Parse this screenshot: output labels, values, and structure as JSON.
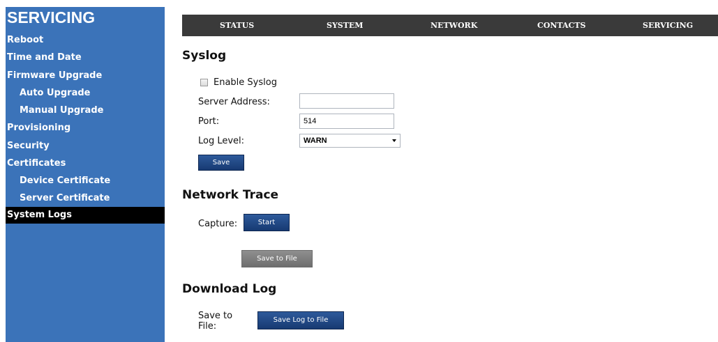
{
  "sidebar": {
    "title": "SERVICING",
    "items": [
      {
        "label": "Reboot"
      },
      {
        "label": "Time and Date"
      },
      {
        "label": "Firmware Upgrade"
      },
      {
        "label": "Auto Upgrade"
      },
      {
        "label": "Manual Upgrade"
      },
      {
        "label": "Provisioning"
      },
      {
        "label": "Security"
      },
      {
        "label": "Certificates"
      },
      {
        "label": "Device Certificate"
      },
      {
        "label": "Server Certificate"
      },
      {
        "label": "System Logs",
        "active": true
      }
    ]
  },
  "topnav": {
    "tabs": [
      "STATUS",
      "SYSTEM",
      "NETWORK",
      "CONTACTS",
      "SERVICING"
    ]
  },
  "syslog": {
    "title": "Syslog",
    "enable_label": "Enable Syslog",
    "enable_checked": false,
    "server_address_label": "Server Address:",
    "server_address_value": "",
    "port_label": "Port:",
    "port_value": "514",
    "log_level_label": "Log Level:",
    "log_level_value": "WARN",
    "save_label": "Save"
  },
  "network_trace": {
    "title": "Network Trace",
    "capture_label": "Capture:",
    "start_label": "Start",
    "save_to_file_label": "Save to File"
  },
  "download_log": {
    "title": "Download Log",
    "save_to_file_label_line1": "Save to",
    "save_to_file_label_line2": "File:",
    "save_log_button": "Save Log to File"
  },
  "colors": {
    "sidebar_bg": "#3b73b9",
    "sidebar_active_bg": "#000000",
    "topnav_bg": "#3a3a3a",
    "button_blue": "#1f4a86",
    "button_gray": "#7f7f7f"
  }
}
